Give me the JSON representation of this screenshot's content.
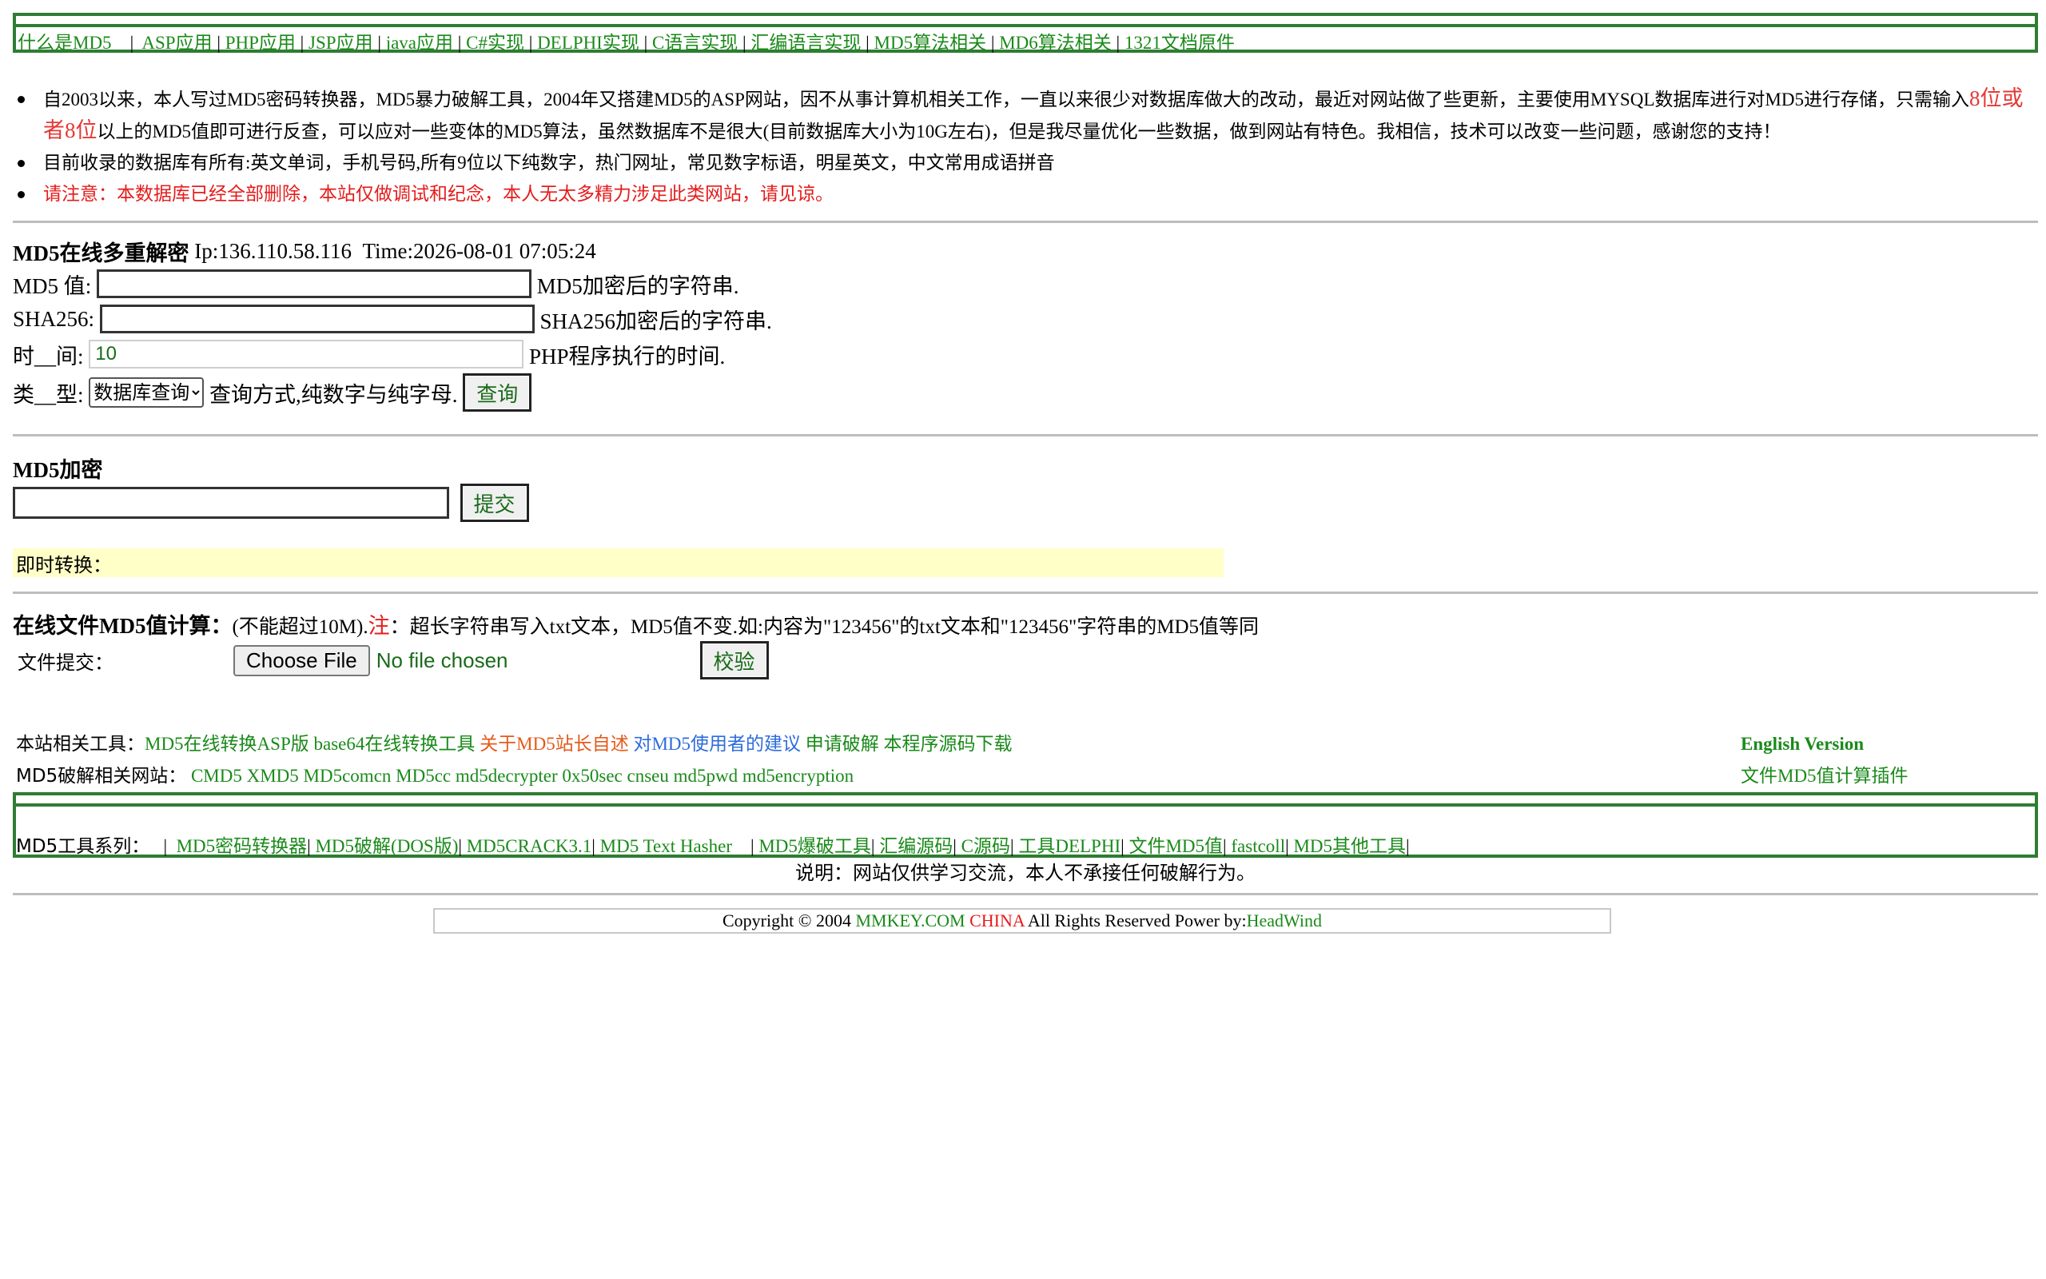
{
  "nav": {
    "items": [
      "什么是MD5",
      "ASP应用",
      "PHP应用",
      "JSP应用",
      "java应用",
      "C#实现",
      "DELPHI实现",
      "C语言实现",
      "汇编语言实现",
      "MD5算法相关",
      "MD6算法相关",
      "1321文档原件"
    ]
  },
  "intro": {
    "p1_a": "自2003以来，本人写过MD5密码转换器，MD5暴力破解工具，2004年又搭建MD5的ASP网站，因不从事计算机相关工作，一直以来很少对数据库做大的改动，最近对网站做了些更新，主要使用MYSQL数据库进行对MD5进行存储，只需输入",
    "p1_highlight": "8位或者8位",
    "p1_b": "以上的MD5值即可进行反查，可以应对一些变体的MD5算法，虽然数据库不是很大(目前数据库大小为10G左右)，但是我尽量优化一些数据，做到网站有特色。我相信，技术可以改变一些问题，感谢您的支持！",
    "p2": "目前收录的数据库有所有:英文单词，手机号码,所有9位以下纯数字，热门网址，常见数字标语，明星英文，中文常用成语拼音",
    "p3": "请注意：本数据库已经全部删除，本站仅做调试和纪念，本人无太多精力涉足此类网站，请见谅。"
  },
  "decode": {
    "title": "MD5在线多重解密",
    "ip": "Ip:136.110.58.116",
    "time": "Time:2026-08-01 07:05:24",
    "md5_label": "MD5 值:",
    "md5_hint": "MD5加密后的字符串.",
    "sha_label": "SHA256:",
    "sha_hint": "SHA256加密后的字符串.",
    "time_label": "时__间:",
    "time_value": "10",
    "time_hint": "PHP程序执行的时间.",
    "type_label": "类__型:",
    "type_selected": "数据库查询",
    "type_hint": "查询方式,纯数字与纯字母.",
    "query_button": "查询"
  },
  "encrypt": {
    "title": "MD5加密",
    "submit_button": "提交",
    "instant_label": "即时转换："
  },
  "file": {
    "title": "在线文件MD5值计算：",
    "note_a": "(不能超过10M).",
    "note_red": "注",
    "note_b": "：超长字符串写入txt文本，MD5值不变.如:内容为\"123456\"的txt文本和\"123456\"字符串的MD5值等同",
    "submit_label": "文件提交：",
    "choose_button": "Choose File",
    "no_file": "No file chosen",
    "verify_button": "校验"
  },
  "tools": {
    "label1": "本站相关工具：",
    "links1": [
      "MD5在线转换ASP版",
      "base64在线转换工具"
    ],
    "link_orange": "关于MD5站长自述",
    "link_blue": "对MD5使用者的建议",
    "links1b": [
      "申请破解",
      "本程序源码下载"
    ],
    "english": "English Version",
    "label2": "MD5破解相关网站：",
    "links2": [
      "CMD5",
      "XMD5",
      "MD5comcn",
      "MD5cc",
      "md5decrypter",
      "0x50sec",
      "cnseu",
      "md5pwd",
      "md5encryption"
    ],
    "plugin": "文件MD5值计算插件"
  },
  "series": {
    "label": "MD5工具系列：",
    "items": [
      "MD5密码转换器",
      "MD5破解(DOS版)",
      "MD5CRACK3.1",
      "MD5 Text Hasher",
      "MD5爆破工具",
      "汇编源码",
      "C源码",
      "工具DELPHI",
      "文件MD5值",
      "fastcoll",
      "MD5其他工具"
    ]
  },
  "notice": "说明：网站仅供学习交流，本人不承接任何破解行为。",
  "copyright": {
    "a": "Copyright © 2004 ",
    "site": "MMKEY.COM",
    "china": " CHINA",
    "b": " All Rights Reserved Power by:",
    "author": "HeadWind"
  }
}
